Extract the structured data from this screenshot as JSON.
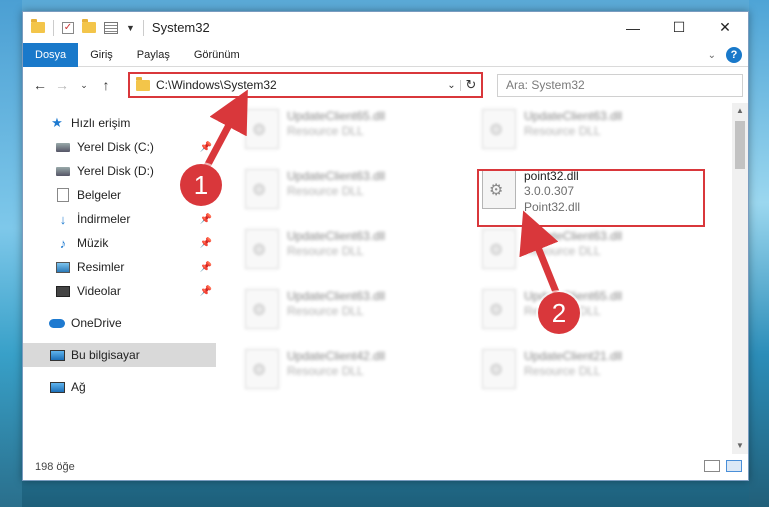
{
  "window": {
    "title": "System32",
    "controls": [
      "—",
      "☐",
      "✕"
    ]
  },
  "ribbon": {
    "tabs": [
      "Dosya",
      "Giriş",
      "Paylaş",
      "Görünüm"
    ],
    "help": "?"
  },
  "nav": {
    "address": "C:\\Windows\\System32",
    "search_placeholder": "Ara: System32"
  },
  "sidebar": {
    "items": [
      {
        "label": "Hızlı erişim",
        "icon": "star-icon"
      },
      {
        "label": "Yerel Disk (C:)",
        "icon": "disk-icon",
        "pinned": true
      },
      {
        "label": "Yerel Disk (D:)",
        "icon": "disk-icon"
      },
      {
        "label": "Belgeler",
        "icon": "documents-icon"
      },
      {
        "label": "İndirmeler",
        "icon": "download-icon",
        "pinned": true
      },
      {
        "label": "Müzik",
        "icon": "music-icon",
        "pinned": true
      },
      {
        "label": "Resimler",
        "icon": "pictures-icon",
        "pinned": true
      },
      {
        "label": "Videolar",
        "icon": "videos-icon",
        "pinned": true
      },
      {
        "label": "OneDrive",
        "icon": "onedrive-icon"
      },
      {
        "label": "Bu bilgisayar",
        "icon": "computer-icon",
        "selected": true
      },
      {
        "label": "Ağ",
        "icon": "network-icon"
      }
    ]
  },
  "files": [
    {
      "name": "UpdateClient65.dll",
      "line2": "Resource DLL",
      "line3": ""
    },
    {
      "name": "UpdateClient63.dll",
      "line2": "Resource DLL",
      "line3": ""
    },
    {
      "name": "UpdateClient63.dll",
      "line2": "Resource DLL",
      "line3": ""
    },
    {
      "name": "point32.dll",
      "line2": "3.0.0.307",
      "line3": "Point32.dll"
    },
    {
      "name": "UpdateClient63.dll",
      "line2": "Resource DLL",
      "line3": ""
    },
    {
      "name": "UpdateClient63.dll",
      "line2": "Resource DLL",
      "line3": ""
    },
    {
      "name": "UpdateClient63.dll",
      "line2": "Resource DLL",
      "line3": ""
    },
    {
      "name": "UpdateClient65.dll",
      "line2": "Resource DLL",
      "line3": ""
    },
    {
      "name": "UpdateClient42.dll",
      "line2": "Resource DLL",
      "line3": ""
    },
    {
      "name": "UpdateClient21.dll",
      "line2": "Resource DLL",
      "line3": ""
    }
  ],
  "status": {
    "count": "198 öğe"
  },
  "callouts": [
    "1",
    "2"
  ],
  "colors": {
    "accent": "#1979ca",
    "highlight": "#d9373b"
  }
}
